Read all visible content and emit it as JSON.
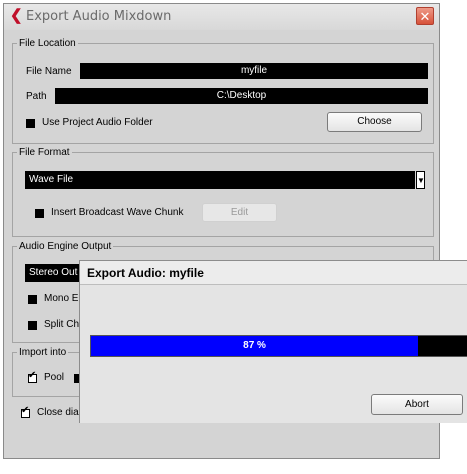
{
  "window": {
    "title": "Export Audio Mixdown",
    "close_glyph": "✕"
  },
  "file_location": {
    "legend": "File Location",
    "file_name_label": "File Name",
    "file_name_value": "myfile",
    "path_label": "Path",
    "path_value": "C:\\Desktop",
    "use_project_folder_label": "Use Project Audio Folder",
    "use_project_folder_checked": false,
    "choose_label": "Choose"
  },
  "file_format": {
    "legend": "File Format",
    "format_value": "Wave File",
    "insert_bwc_label": "Insert Broadcast Wave Chunk",
    "insert_bwc_checked": false,
    "edit_label": "Edit"
  },
  "audio_engine_output": {
    "legend": "Audio Engine Output",
    "output_value": "Stereo Out",
    "mono_label": "Mono E",
    "split_label": "Split Ch"
  },
  "import_into": {
    "legend": "Import into",
    "pool_label": "Pool",
    "pool_checked": true
  },
  "close_dialog_label": "Close dia",
  "close_dialog_checked": true,
  "progress_dialog": {
    "title": "Export Audio: myfile",
    "progress_percent": 87,
    "progress_text": "87 %",
    "abort_label": "Abort"
  },
  "colors": {
    "progress_fill": "#0000ff",
    "field_background": "#000000",
    "close_button": "#d7523a"
  },
  "icons": {
    "app": "cubase-logo-icon",
    "close": "close-icon",
    "dropdown": "chevron-down-icon"
  }
}
